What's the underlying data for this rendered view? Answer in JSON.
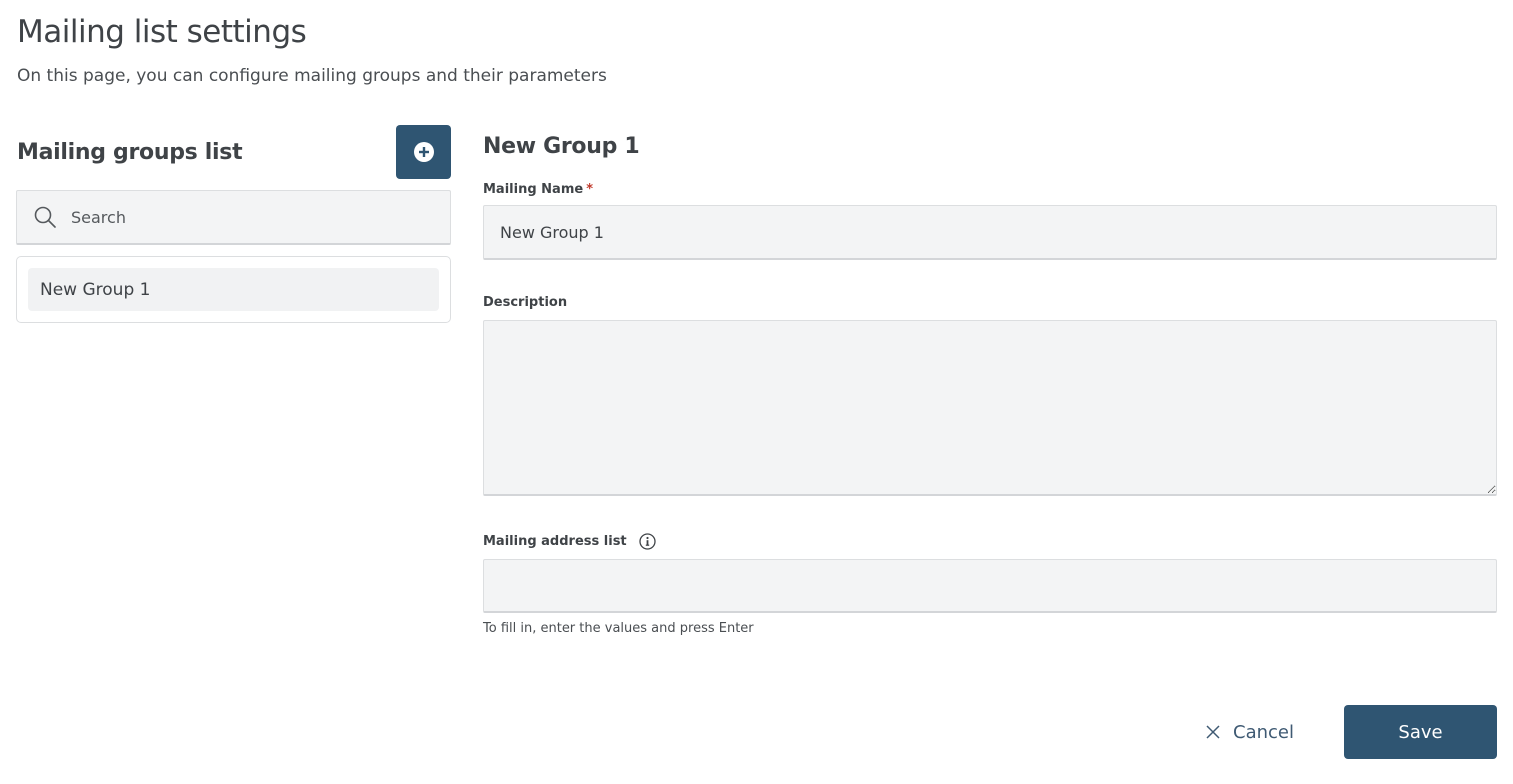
{
  "header": {
    "title": "Mailing list settings",
    "subtitle": "On this page, you can configure mailing groups and their parameters"
  },
  "groups_panel": {
    "title": "Mailing groups list",
    "add_button_icon": "plus-circle-icon",
    "search": {
      "placeholder": "Search",
      "value": "",
      "icon": "search-icon"
    },
    "items": [
      {
        "label": "New Group 1",
        "selected": true
      }
    ]
  },
  "form": {
    "title": "New Group 1",
    "mailing_name": {
      "label": "Mailing Name",
      "required_mark": "*",
      "value": "New Group 1"
    },
    "description": {
      "label": "Description",
      "value": ""
    },
    "address_list": {
      "label": "Mailing address list",
      "info_icon": "info-icon",
      "value": "",
      "hint": "To fill in, enter the values and press Enter"
    }
  },
  "actions": {
    "cancel_label": "Cancel",
    "cancel_icon": "close-icon",
    "save_label": "Save"
  },
  "colors": {
    "primary": "#2f5572",
    "field_bg": "#f3f4f5",
    "text": "#3f4347",
    "required": "#c0392b"
  }
}
